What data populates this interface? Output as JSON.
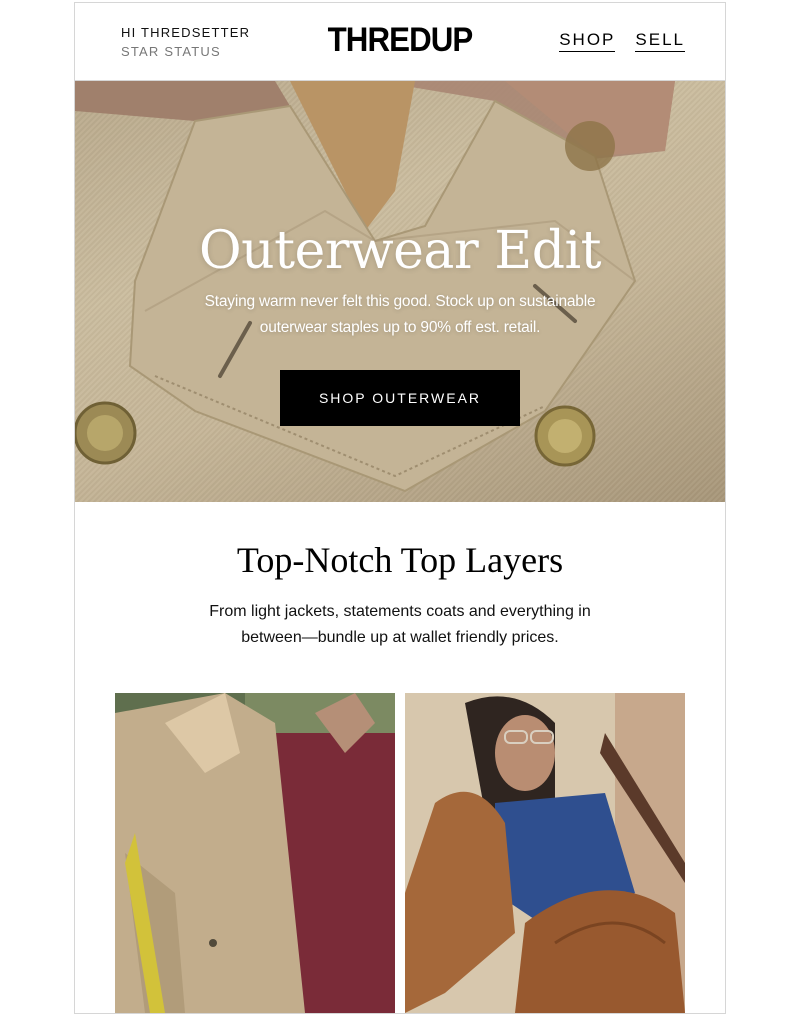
{
  "header": {
    "greeting": "HI THREDSETTER",
    "status": "STAR STATUS",
    "logo": "THREDUP",
    "nav": {
      "shop": "SHOP",
      "sell": "SELL"
    }
  },
  "hero": {
    "title": "Outerwear Edit",
    "subtitle": "Staying warm never felt this good. Stock up on sustainable outerwear staples up to 90% off est. retail.",
    "cta": "SHOP OUTERWEAR"
  },
  "section": {
    "title": "Top-Notch Top Layers",
    "subtitle": "From light jackets, statements coats and everything in between—bundle up at wallet friendly prices."
  },
  "colors": {
    "accent": "#000000",
    "trench": "#c9b99b",
    "leather": "#a5683a",
    "denim": "#2f4f8f",
    "burgundy": "#7b2a36"
  }
}
